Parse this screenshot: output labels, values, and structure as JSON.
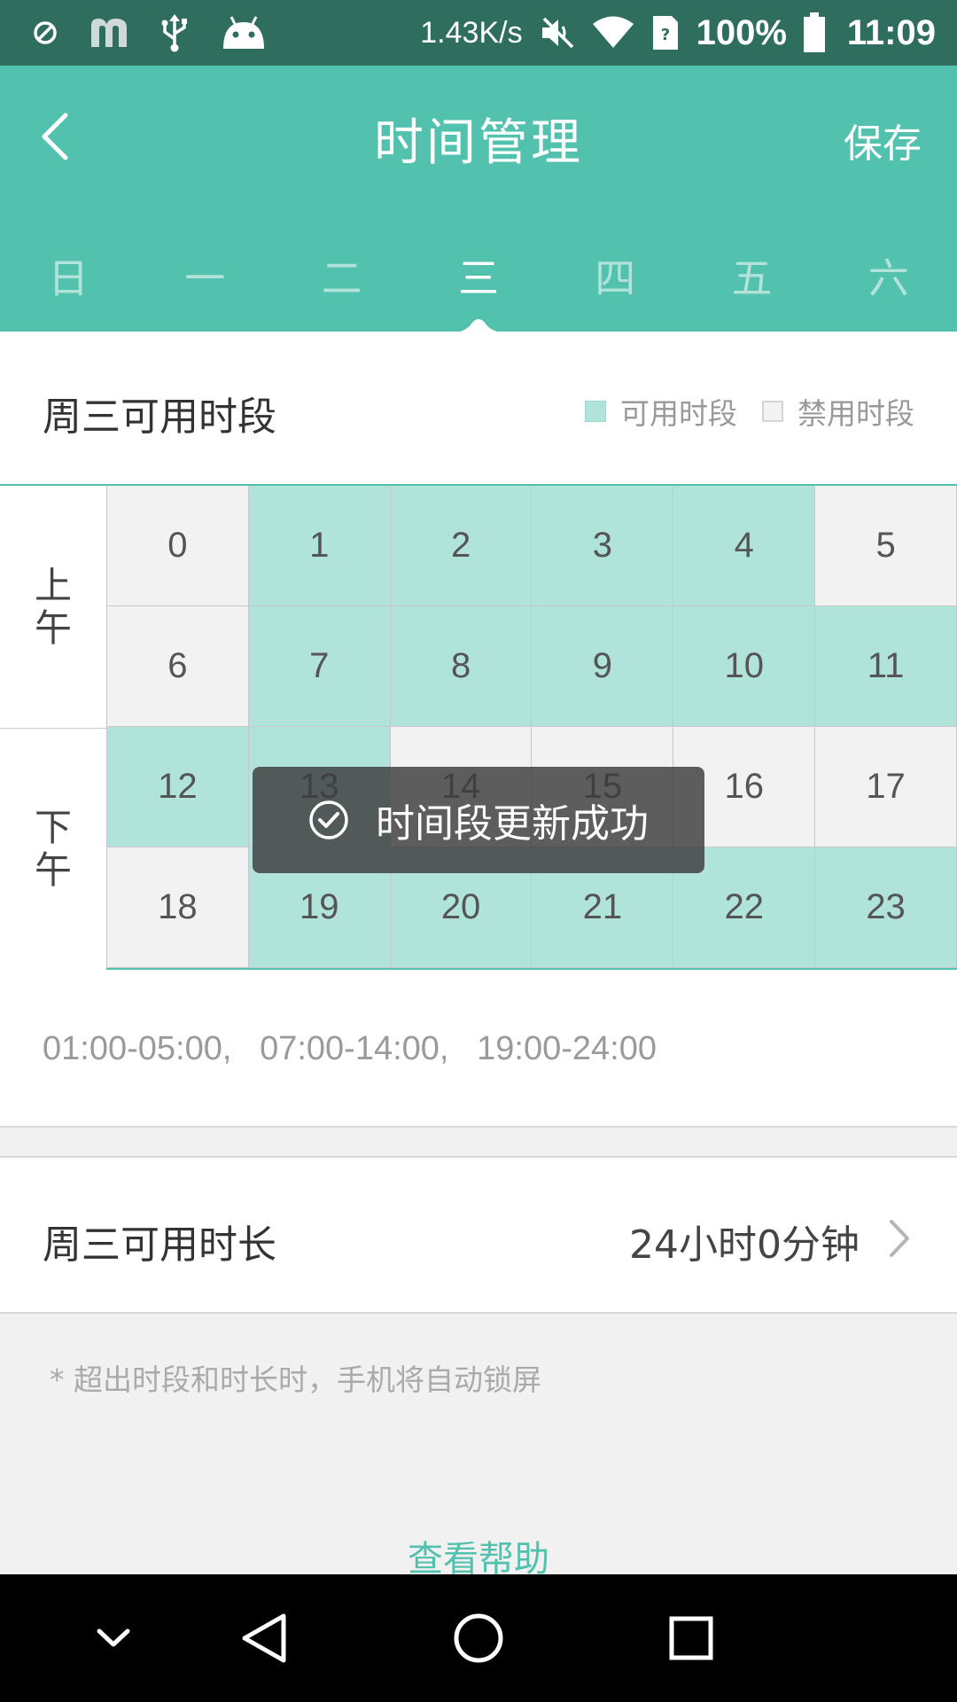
{
  "status_bar": {
    "speed": "1.43K/s",
    "battery": "100%",
    "time": "11:09",
    "icons": [
      "blocked-icon",
      "m-app-icon",
      "usb-icon",
      "android-icon",
      "mute-icon",
      "wifi-icon",
      "sim-icon",
      "battery-icon"
    ]
  },
  "header": {
    "title": "时间管理",
    "save_label": "保存",
    "back_icon": "chevron-left-icon",
    "tabs": [
      {
        "label": "日"
      },
      {
        "label": "一"
      },
      {
        "label": "二"
      },
      {
        "label": "三",
        "active": true
      },
      {
        "label": "四"
      },
      {
        "label": "五"
      },
      {
        "label": "六"
      }
    ]
  },
  "section": {
    "title": "周三可用时段",
    "legend_available": "可用时段",
    "legend_disabled": "禁用时段"
  },
  "grid": {
    "am_label": [
      "上",
      "午"
    ],
    "pm_label": [
      "下",
      "午"
    ],
    "hours": [
      {
        "h": "0",
        "on": false
      },
      {
        "h": "1",
        "on": true
      },
      {
        "h": "2",
        "on": true
      },
      {
        "h": "3",
        "on": true
      },
      {
        "h": "4",
        "on": true
      },
      {
        "h": "5",
        "on": false
      },
      {
        "h": "6",
        "on": false
      },
      {
        "h": "7",
        "on": true
      },
      {
        "h": "8",
        "on": true
      },
      {
        "h": "9",
        "on": true
      },
      {
        "h": "10",
        "on": true
      },
      {
        "h": "11",
        "on": true
      },
      {
        "h": "12",
        "on": true
      },
      {
        "h": "13",
        "on": true
      },
      {
        "h": "14",
        "on": false
      },
      {
        "h": "15",
        "on": false
      },
      {
        "h": "16",
        "on": false
      },
      {
        "h": "17",
        "on": false
      },
      {
        "h": "18",
        "on": false
      },
      {
        "h": "19",
        "on": true
      },
      {
        "h": "20",
        "on": true
      },
      {
        "h": "21",
        "on": true
      },
      {
        "h": "22",
        "on": true
      },
      {
        "h": "23",
        "on": true
      }
    ],
    "colors": {
      "available": "#b0e3d9",
      "disabled": "#f2f2f2"
    }
  },
  "ranges_text": "01:00-05:00,   07:00-14:00,   19:00-24:00",
  "duration": {
    "label": "周三可用时长",
    "value": "24小时0分钟"
  },
  "note": "* 超出时段和时长时，手机将自动锁屏",
  "help_link": "查看帮助",
  "toast": {
    "text": "时间段更新成功",
    "icon": "check-circle-icon"
  },
  "colors": {
    "accent": "#52c1ad",
    "status_bar": "#2f6e5f"
  }
}
